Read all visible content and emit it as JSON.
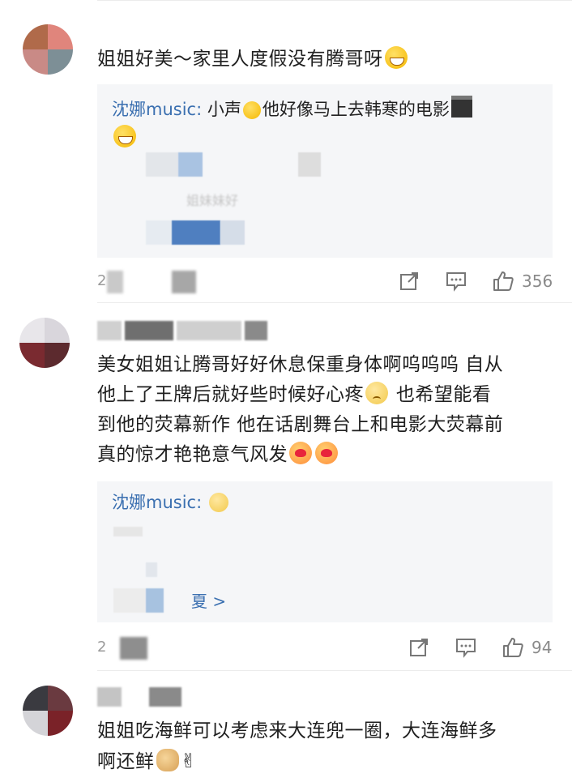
{
  "comments": [
    {
      "text_before_emoji": "姐姐好美～家里人度假没有腾哥呀",
      "reply": {
        "name": "沈娜music:",
        "line1": "小声",
        "line1b": "他好像马上去韩寒的电影",
        "blurred_caption": "姐妹妹好"
      },
      "footer": {
        "count_digit": "2",
        "like_count": "356"
      }
    },
    {
      "lines": [
        "美女姐姐让腾哥好好休息保重身体啊呜呜呜 自从",
        "他上了王牌后就好些时候好心疼",
        "也希望能看",
        "到他的荧幕新作 他在话剧舞台上和电影大荧幕前",
        "真的惊才艳艳意气风发"
      ],
      "reply": {
        "name": "沈娜music:",
        "more_arrow": "夏 >"
      },
      "footer": {
        "count_digit": "2",
        "like_count": "94"
      }
    },
    {
      "lines": [
        "姐姐吃海鲜可以考虑来大连兜一圈，大连海鲜多",
        "啊还鲜"
      ]
    }
  ],
  "icons": {
    "share": "share-icon",
    "comment": "comment-icon",
    "like": "thumbs-up-icon"
  },
  "colors": {
    "reply_name": "#3a6fb0",
    "reply_bg": "#f5f6f8",
    "meta": "#8a8a8a"
  }
}
